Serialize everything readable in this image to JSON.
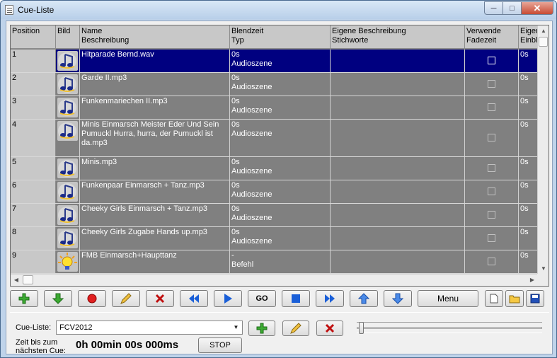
{
  "window": {
    "title": "Cue-Liste"
  },
  "columns": {
    "position": "Position",
    "bild": "Bild",
    "name": "Name\nBeschreibung",
    "blendzeit": "Blendzeit\nTyp",
    "eigene": "Eigene Beschreibung\nStichworte",
    "fade": "Verwende\nFadezeit",
    "einbl": "Eigen\nEinbl"
  },
  "rows": [
    {
      "pos": "1",
      "name": "Hitparade Bernd.wav",
      "time": "0s",
      "typ": "Audioszene",
      "extra": "0s",
      "icon": "music-note-icon",
      "selected": true
    },
    {
      "pos": "2",
      "name": "Garde II.mp3",
      "time": "0s",
      "typ": "Audioszene",
      "extra": "0s",
      "icon": "music-note-icon"
    },
    {
      "pos": "3",
      "name": "Funkenmariechen II.mp3",
      "time": "0s",
      "typ": "Audioszene",
      "extra": "0s",
      "icon": "music-note-icon"
    },
    {
      "pos": "4",
      "name": "Minis Einmarsch Meister Eder Und Sein Pumuckl Hurra, hurra, der Pumuckl ist da.mp3",
      "time": "0s",
      "typ": "Audioszene",
      "extra": "0s",
      "icon": "music-note-icon"
    },
    {
      "pos": "5",
      "name": "Minis.mp3",
      "time": "0s",
      "typ": "Audioszene",
      "extra": "0s",
      "icon": "music-note-icon"
    },
    {
      "pos": "6",
      "name": "Funkenpaar Einmarsch + Tanz.mp3",
      "time": "0s",
      "typ": "Audioszene",
      "extra": "0s",
      "icon": "music-note-icon"
    },
    {
      "pos": "7",
      "name": "Cheeky Girls Einmarsch + Tanz.mp3",
      "time": "0s",
      "typ": "Audioszene",
      "extra": "0s",
      "icon": "music-note-icon"
    },
    {
      "pos": "8",
      "name": "Cheeky Girls Zugabe Hands up.mp3",
      "time": "0s",
      "typ": "Audioszene",
      "extra": "0s",
      "icon": "music-note-icon"
    },
    {
      "pos": "9",
      "name": "FMB Einmarsch+Haupttanz",
      "time": "-",
      "typ": "Befehl",
      "extra": "0s",
      "icon": "lightbulb-icon"
    }
  ],
  "toolbar": {
    "go_label": "GO",
    "menu_label": "Menu"
  },
  "bottom": {
    "cueliste_label": "Cue-Liste:",
    "cueliste_value": "FCV2012",
    "zeit_label_1": "Zeit bis zum",
    "zeit_label_2": "nächsten Cue:",
    "timer": "0h 00min 00s 000ms",
    "stop_label": "STOP"
  },
  "colors": {
    "grid_bg": "#808080",
    "selected_row": "#000080",
    "header_bg": "#c8c8c8"
  }
}
